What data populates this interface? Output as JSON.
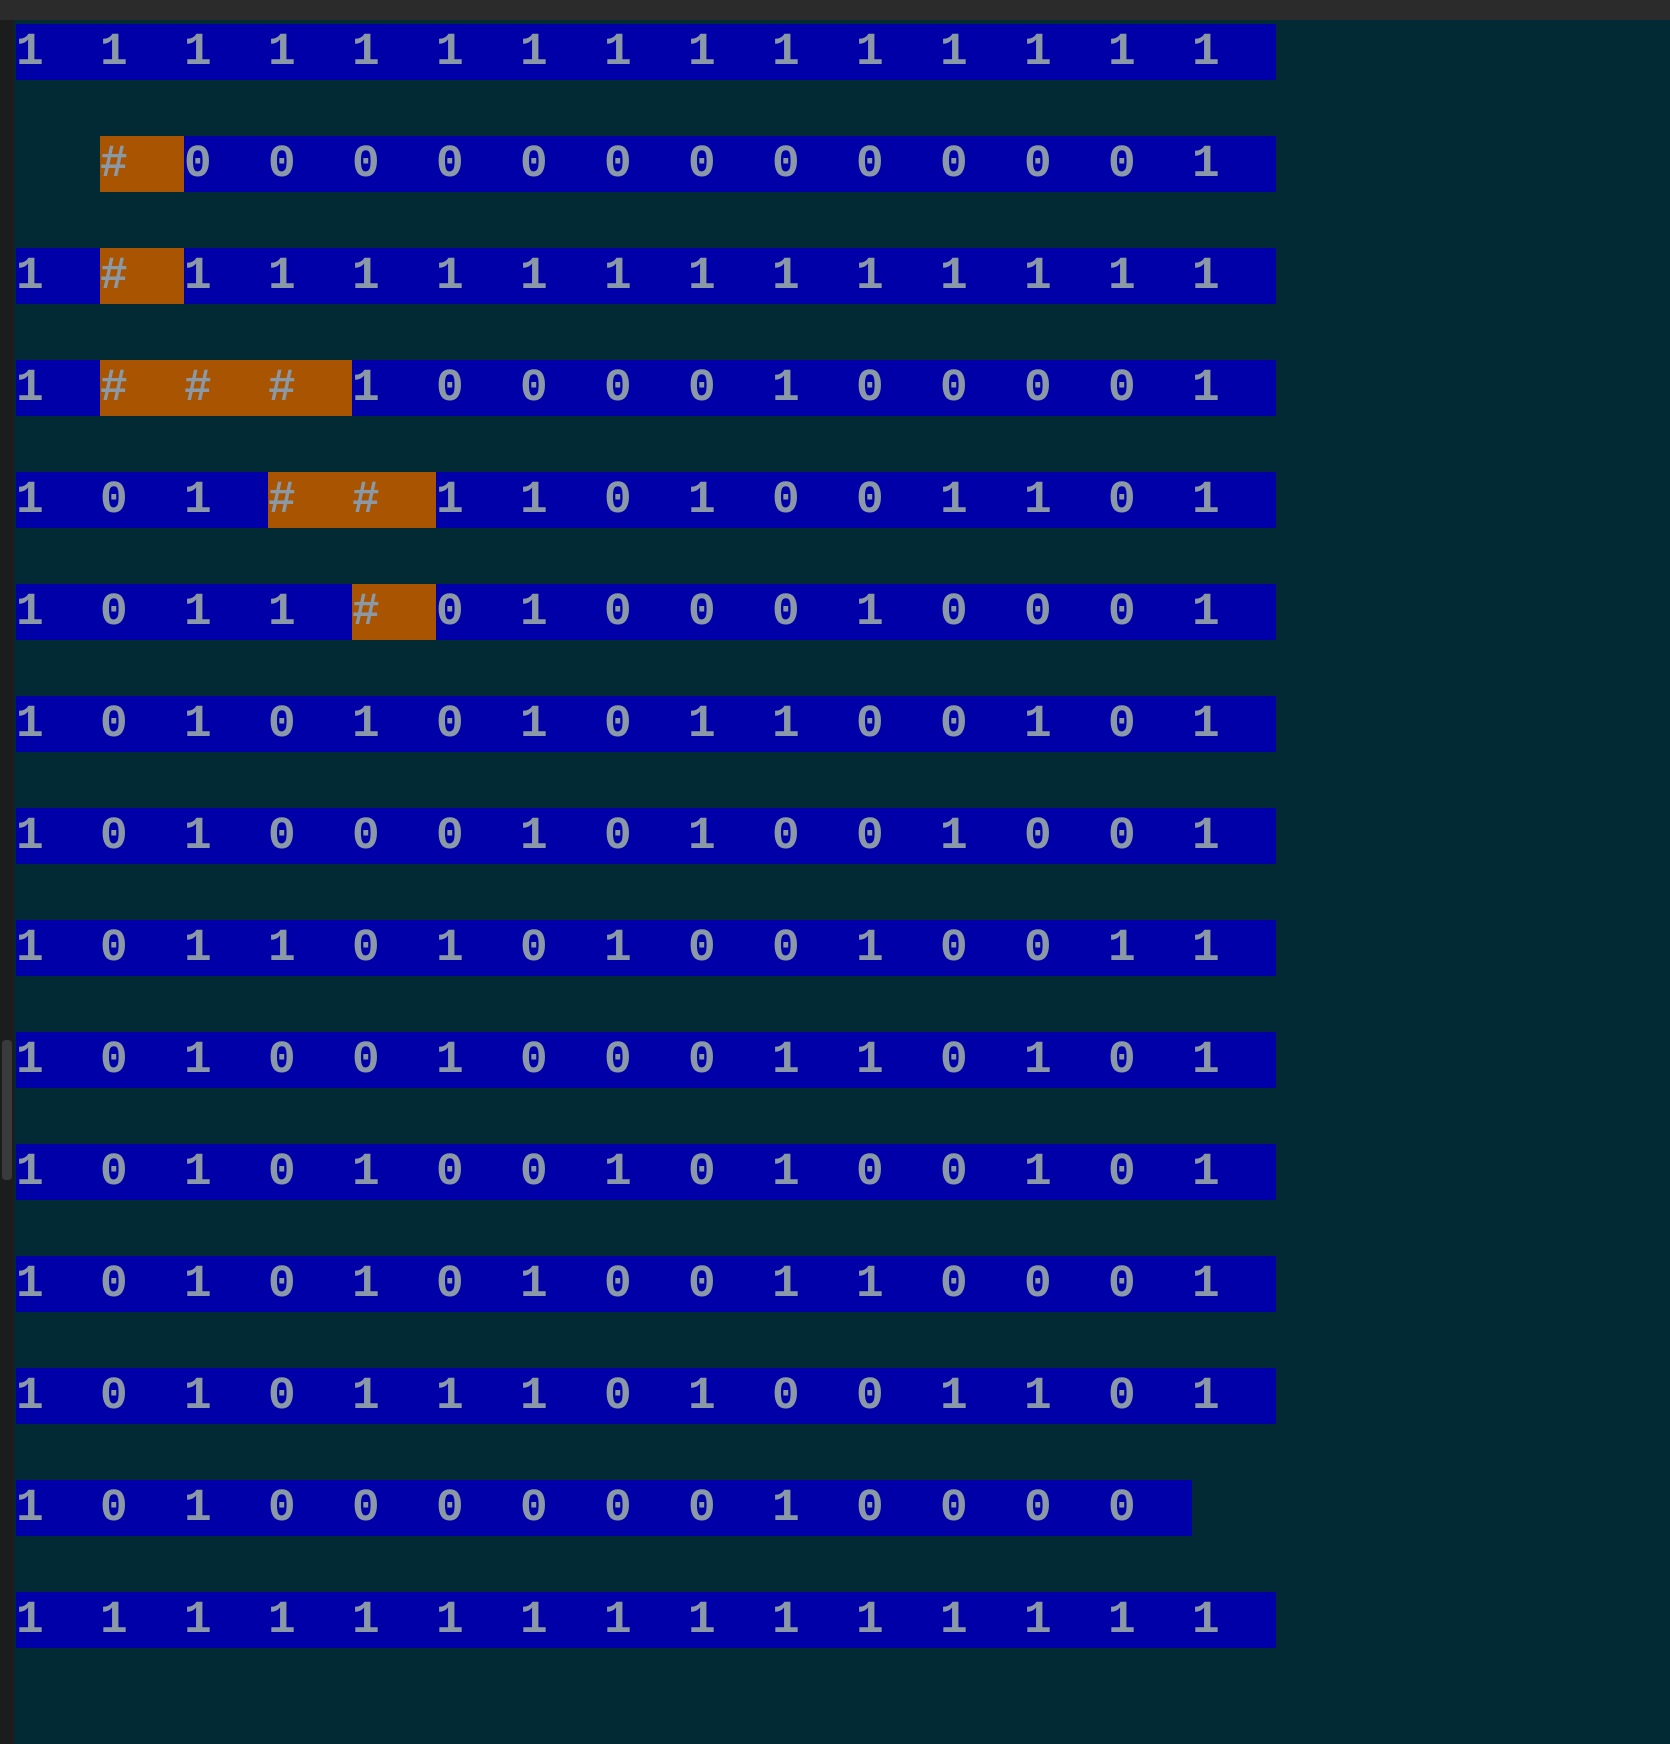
{
  "maze": {
    "rows": [
      {
        "cells": [
          {
            "kind": "digit",
            "text": "1"
          },
          {
            "kind": "digit",
            "text": "1"
          },
          {
            "kind": "digit",
            "text": "1"
          },
          {
            "kind": "digit",
            "text": "1"
          },
          {
            "kind": "digit",
            "text": "1"
          },
          {
            "kind": "digit",
            "text": "1"
          },
          {
            "kind": "digit",
            "text": "1"
          },
          {
            "kind": "digit",
            "text": "1"
          },
          {
            "kind": "digit",
            "text": "1"
          },
          {
            "kind": "digit",
            "text": "1"
          },
          {
            "kind": "digit",
            "text": "1"
          },
          {
            "kind": "digit",
            "text": "1"
          },
          {
            "kind": "digit",
            "text": "1"
          },
          {
            "kind": "digit",
            "text": "1"
          },
          {
            "kind": "digit",
            "text": "1"
          }
        ]
      },
      {
        "cells": [
          {
            "kind": "blank"
          },
          {
            "kind": "path",
            "text": "#"
          },
          {
            "kind": "digit",
            "text": "0"
          },
          {
            "kind": "digit",
            "text": "0"
          },
          {
            "kind": "digit",
            "text": "0"
          },
          {
            "kind": "digit",
            "text": "0"
          },
          {
            "kind": "digit",
            "text": "0"
          },
          {
            "kind": "digit",
            "text": "0"
          },
          {
            "kind": "digit",
            "text": "0"
          },
          {
            "kind": "digit",
            "text": "0"
          },
          {
            "kind": "digit",
            "text": "0"
          },
          {
            "kind": "digit",
            "text": "0"
          },
          {
            "kind": "digit",
            "text": "0"
          },
          {
            "kind": "digit",
            "text": "0"
          },
          {
            "kind": "digit",
            "text": "1"
          }
        ]
      },
      {
        "cells": [
          {
            "kind": "digit",
            "text": "1"
          },
          {
            "kind": "path",
            "text": "#"
          },
          {
            "kind": "digit",
            "text": "1"
          },
          {
            "kind": "digit",
            "text": "1"
          },
          {
            "kind": "digit",
            "text": "1"
          },
          {
            "kind": "digit",
            "text": "1"
          },
          {
            "kind": "digit",
            "text": "1"
          },
          {
            "kind": "digit",
            "text": "1"
          },
          {
            "kind": "digit",
            "text": "1"
          },
          {
            "kind": "digit",
            "text": "1"
          },
          {
            "kind": "digit",
            "text": "1"
          },
          {
            "kind": "digit",
            "text": "1"
          },
          {
            "kind": "digit",
            "text": "1"
          },
          {
            "kind": "digit",
            "text": "1"
          },
          {
            "kind": "digit",
            "text": "1"
          }
        ]
      },
      {
        "cells": [
          {
            "kind": "digit",
            "text": "1"
          },
          {
            "kind": "path",
            "text": "#"
          },
          {
            "kind": "path",
            "text": "#"
          },
          {
            "kind": "path",
            "text": "#"
          },
          {
            "kind": "digit",
            "text": "1"
          },
          {
            "kind": "digit",
            "text": "0"
          },
          {
            "kind": "digit",
            "text": "0"
          },
          {
            "kind": "digit",
            "text": "0"
          },
          {
            "kind": "digit",
            "text": "0"
          },
          {
            "kind": "digit",
            "text": "1"
          },
          {
            "kind": "digit",
            "text": "0"
          },
          {
            "kind": "digit",
            "text": "0"
          },
          {
            "kind": "digit",
            "text": "0"
          },
          {
            "kind": "digit",
            "text": "0"
          },
          {
            "kind": "digit",
            "text": "1"
          }
        ]
      },
      {
        "cells": [
          {
            "kind": "digit",
            "text": "1"
          },
          {
            "kind": "digit",
            "text": "0"
          },
          {
            "kind": "digit",
            "text": "1"
          },
          {
            "kind": "path",
            "text": "#"
          },
          {
            "kind": "path",
            "text": "#"
          },
          {
            "kind": "digit",
            "text": "1"
          },
          {
            "kind": "digit",
            "text": "1"
          },
          {
            "kind": "digit",
            "text": "0"
          },
          {
            "kind": "digit",
            "text": "1"
          },
          {
            "kind": "digit",
            "text": "0"
          },
          {
            "kind": "digit",
            "text": "0"
          },
          {
            "kind": "digit",
            "text": "1"
          },
          {
            "kind": "digit",
            "text": "1"
          },
          {
            "kind": "digit",
            "text": "0"
          },
          {
            "kind": "digit",
            "text": "1"
          }
        ]
      },
      {
        "cells": [
          {
            "kind": "digit",
            "text": "1"
          },
          {
            "kind": "digit",
            "text": "0"
          },
          {
            "kind": "digit",
            "text": "1"
          },
          {
            "kind": "digit",
            "text": "1"
          },
          {
            "kind": "path",
            "text": "#"
          },
          {
            "kind": "digit",
            "text": "0"
          },
          {
            "kind": "digit",
            "text": "1"
          },
          {
            "kind": "digit",
            "text": "0"
          },
          {
            "kind": "digit",
            "text": "0"
          },
          {
            "kind": "digit",
            "text": "0"
          },
          {
            "kind": "digit",
            "text": "1"
          },
          {
            "kind": "digit",
            "text": "0"
          },
          {
            "kind": "digit",
            "text": "0"
          },
          {
            "kind": "digit",
            "text": "0"
          },
          {
            "kind": "digit",
            "text": "1"
          }
        ]
      },
      {
        "cells": [
          {
            "kind": "digit",
            "text": "1"
          },
          {
            "kind": "digit",
            "text": "0"
          },
          {
            "kind": "digit",
            "text": "1"
          },
          {
            "kind": "digit",
            "text": "0"
          },
          {
            "kind": "digit",
            "text": "1"
          },
          {
            "kind": "digit",
            "text": "0"
          },
          {
            "kind": "digit",
            "text": "1"
          },
          {
            "kind": "digit",
            "text": "0"
          },
          {
            "kind": "digit",
            "text": "1"
          },
          {
            "kind": "digit",
            "text": "1"
          },
          {
            "kind": "digit",
            "text": "0"
          },
          {
            "kind": "digit",
            "text": "0"
          },
          {
            "kind": "digit",
            "text": "1"
          },
          {
            "kind": "digit",
            "text": "0"
          },
          {
            "kind": "digit",
            "text": "1"
          }
        ]
      },
      {
        "cells": [
          {
            "kind": "digit",
            "text": "1"
          },
          {
            "kind": "digit",
            "text": "0"
          },
          {
            "kind": "digit",
            "text": "1"
          },
          {
            "kind": "digit",
            "text": "0"
          },
          {
            "kind": "digit",
            "text": "0"
          },
          {
            "kind": "digit",
            "text": "0"
          },
          {
            "kind": "digit",
            "text": "1"
          },
          {
            "kind": "digit",
            "text": "0"
          },
          {
            "kind": "digit",
            "text": "1"
          },
          {
            "kind": "digit",
            "text": "0"
          },
          {
            "kind": "digit",
            "text": "0"
          },
          {
            "kind": "digit",
            "text": "1"
          },
          {
            "kind": "digit",
            "text": "0"
          },
          {
            "kind": "digit",
            "text": "0"
          },
          {
            "kind": "digit",
            "text": "1"
          }
        ]
      },
      {
        "cells": [
          {
            "kind": "digit",
            "text": "1"
          },
          {
            "kind": "digit",
            "text": "0"
          },
          {
            "kind": "digit",
            "text": "1"
          },
          {
            "kind": "digit",
            "text": "1"
          },
          {
            "kind": "digit",
            "text": "0"
          },
          {
            "kind": "digit",
            "text": "1"
          },
          {
            "kind": "digit",
            "text": "0"
          },
          {
            "kind": "digit",
            "text": "1"
          },
          {
            "kind": "digit",
            "text": "0"
          },
          {
            "kind": "digit",
            "text": "0"
          },
          {
            "kind": "digit",
            "text": "1"
          },
          {
            "kind": "digit",
            "text": "0"
          },
          {
            "kind": "digit",
            "text": "0"
          },
          {
            "kind": "digit",
            "text": "1"
          },
          {
            "kind": "digit",
            "text": "1"
          }
        ]
      },
      {
        "cells": [
          {
            "kind": "digit",
            "text": "1"
          },
          {
            "kind": "digit",
            "text": "0"
          },
          {
            "kind": "digit",
            "text": "1"
          },
          {
            "kind": "digit",
            "text": "0"
          },
          {
            "kind": "digit",
            "text": "0"
          },
          {
            "kind": "digit",
            "text": "1"
          },
          {
            "kind": "digit",
            "text": "0"
          },
          {
            "kind": "digit",
            "text": "0"
          },
          {
            "kind": "digit",
            "text": "0"
          },
          {
            "kind": "digit",
            "text": "1"
          },
          {
            "kind": "digit",
            "text": "1"
          },
          {
            "kind": "digit",
            "text": "0"
          },
          {
            "kind": "digit",
            "text": "1"
          },
          {
            "kind": "digit",
            "text": "0"
          },
          {
            "kind": "digit",
            "text": "1"
          }
        ]
      },
      {
        "cells": [
          {
            "kind": "digit",
            "text": "1"
          },
          {
            "kind": "digit",
            "text": "0"
          },
          {
            "kind": "digit",
            "text": "1"
          },
          {
            "kind": "digit",
            "text": "0"
          },
          {
            "kind": "digit",
            "text": "1"
          },
          {
            "kind": "digit",
            "text": "0"
          },
          {
            "kind": "digit",
            "text": "0"
          },
          {
            "kind": "digit",
            "text": "1"
          },
          {
            "kind": "digit",
            "text": "0"
          },
          {
            "kind": "digit",
            "text": "1"
          },
          {
            "kind": "digit",
            "text": "0"
          },
          {
            "kind": "digit",
            "text": "0"
          },
          {
            "kind": "digit",
            "text": "1"
          },
          {
            "kind": "digit",
            "text": "0"
          },
          {
            "kind": "digit",
            "text": "1"
          }
        ]
      },
      {
        "cells": [
          {
            "kind": "digit",
            "text": "1"
          },
          {
            "kind": "digit",
            "text": "0"
          },
          {
            "kind": "digit",
            "text": "1"
          },
          {
            "kind": "digit",
            "text": "0"
          },
          {
            "kind": "digit",
            "text": "1"
          },
          {
            "kind": "digit",
            "text": "0"
          },
          {
            "kind": "digit",
            "text": "1"
          },
          {
            "kind": "digit",
            "text": "0"
          },
          {
            "kind": "digit",
            "text": "0"
          },
          {
            "kind": "digit",
            "text": "1"
          },
          {
            "kind": "digit",
            "text": "1"
          },
          {
            "kind": "digit",
            "text": "0"
          },
          {
            "kind": "digit",
            "text": "0"
          },
          {
            "kind": "digit",
            "text": "0"
          },
          {
            "kind": "digit",
            "text": "1"
          }
        ]
      },
      {
        "cells": [
          {
            "kind": "digit",
            "text": "1"
          },
          {
            "kind": "digit",
            "text": "0"
          },
          {
            "kind": "digit",
            "text": "1"
          },
          {
            "kind": "digit",
            "text": "0"
          },
          {
            "kind": "digit",
            "text": "1"
          },
          {
            "kind": "digit",
            "text": "1"
          },
          {
            "kind": "digit",
            "text": "1"
          },
          {
            "kind": "digit",
            "text": "0"
          },
          {
            "kind": "digit",
            "text": "1"
          },
          {
            "kind": "digit",
            "text": "0"
          },
          {
            "kind": "digit",
            "text": "0"
          },
          {
            "kind": "digit",
            "text": "1"
          },
          {
            "kind": "digit",
            "text": "1"
          },
          {
            "kind": "digit",
            "text": "0"
          },
          {
            "kind": "digit",
            "text": "1"
          }
        ]
      },
      {
        "cells": [
          {
            "kind": "digit",
            "text": "1"
          },
          {
            "kind": "digit",
            "text": "0"
          },
          {
            "kind": "digit",
            "text": "1"
          },
          {
            "kind": "digit",
            "text": "0"
          },
          {
            "kind": "digit",
            "text": "0"
          },
          {
            "kind": "digit",
            "text": "0"
          },
          {
            "kind": "digit",
            "text": "0"
          },
          {
            "kind": "digit",
            "text": "0"
          },
          {
            "kind": "digit",
            "text": "0"
          },
          {
            "kind": "digit",
            "text": "1"
          },
          {
            "kind": "digit",
            "text": "0"
          },
          {
            "kind": "digit",
            "text": "0"
          },
          {
            "kind": "digit",
            "text": "0"
          },
          {
            "kind": "digit",
            "text": "0"
          }
        ]
      },
      {
        "cells": [
          {
            "kind": "digit",
            "text": "1"
          },
          {
            "kind": "digit",
            "text": "1"
          },
          {
            "kind": "digit",
            "text": "1"
          },
          {
            "kind": "digit",
            "text": "1"
          },
          {
            "kind": "digit",
            "text": "1"
          },
          {
            "kind": "digit",
            "text": "1"
          },
          {
            "kind": "digit",
            "text": "1"
          },
          {
            "kind": "digit",
            "text": "1"
          },
          {
            "kind": "digit",
            "text": "1"
          },
          {
            "kind": "digit",
            "text": "1"
          },
          {
            "kind": "digit",
            "text": "1"
          },
          {
            "kind": "digit",
            "text": "1"
          },
          {
            "kind": "digit",
            "text": "1"
          },
          {
            "kind": "digit",
            "text": "1"
          },
          {
            "kind": "digit",
            "text": "1"
          }
        ]
      }
    ]
  }
}
